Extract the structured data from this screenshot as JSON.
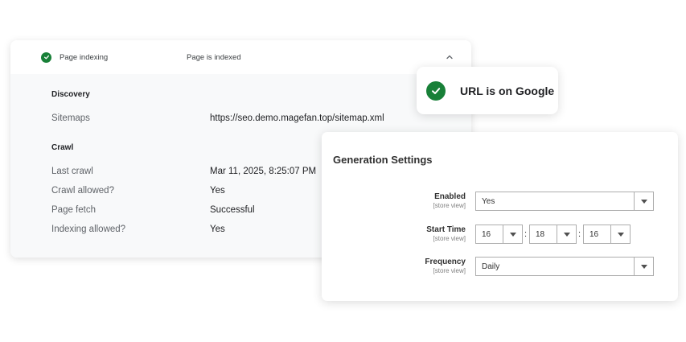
{
  "gsc": {
    "header_title": "Page indexing",
    "header_status": "Page is indexed",
    "discovery_heading": "Discovery",
    "sitemaps_label": "Sitemaps",
    "sitemaps_value": "https://seo.demo.magefan.top/sitemap.xml",
    "crawl_heading": "Crawl",
    "rows": [
      {
        "label": "Last crawl",
        "value": "Mar 11, 2025, 8:25:07 PM"
      },
      {
        "label": "Crawl allowed?",
        "value": "Yes"
      },
      {
        "label": "Page fetch",
        "value": "Successful"
      },
      {
        "label": "Indexing allowed?",
        "value": "Yes"
      }
    ]
  },
  "badge": {
    "text": "URL is on Google"
  },
  "generation": {
    "title": "Generation Settings",
    "enabled_label": "Enabled",
    "enabled_scope": "[store view]",
    "enabled_value": "Yes",
    "start_time_label": "Start Time",
    "start_time_scope": "[store view]",
    "hour": "16",
    "minute": "18",
    "second": "16",
    "separator": ":",
    "frequency_label": "Frequency",
    "frequency_scope": "[store view]",
    "frequency_value": "Daily"
  },
  "colors": {
    "check_green": "#188038",
    "text_dark": "#202124",
    "text_muted": "#5f6368",
    "panel_bg": "#f8f9fa"
  },
  "icons": [
    "check-circle-icon",
    "chevron-up-icon",
    "dropdown-arrow-icon"
  ]
}
